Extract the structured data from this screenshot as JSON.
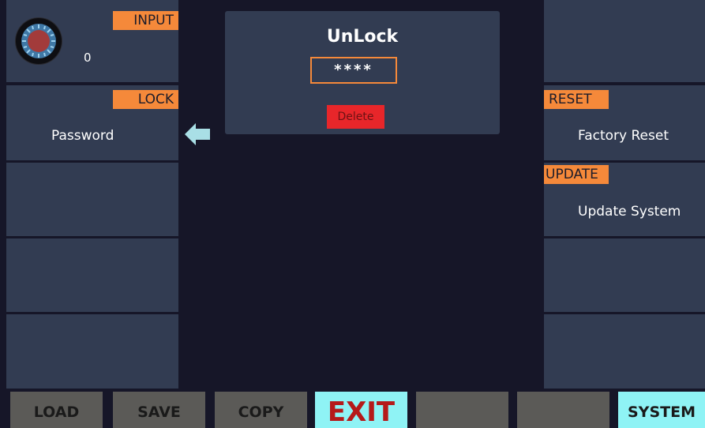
{
  "left_panels": {
    "input_tag": "INPUT",
    "knob_value": "0",
    "lock_tag": "LOCK",
    "password_label": "Password"
  },
  "dialog": {
    "title": "UnLock",
    "password_mask": "****",
    "delete_label": "Delete"
  },
  "right_panels": {
    "reset_tag": "RESET",
    "factory_reset_label": "Factory Reset",
    "update_tag": "UPDATE",
    "update_system_label": "Update System"
  },
  "bottom_bar": {
    "load": "LOAD",
    "save": "SAVE",
    "copy": "COPY",
    "exit": "EXIT",
    "blank1": "",
    "blank2": "",
    "system": "SYSTEM"
  },
  "colors": {
    "background": "#161628",
    "panel": "#323c52",
    "tag": "#f5893a",
    "active_button": "#8ff3f5",
    "inactive_button": "#5b5a57",
    "exit_text": "#b51a1a",
    "delete": "#e8262a",
    "arrow": "#a9dfe6"
  },
  "icons": {
    "knob": "rotary-knob-icon",
    "arrow": "arrow-left-icon"
  }
}
